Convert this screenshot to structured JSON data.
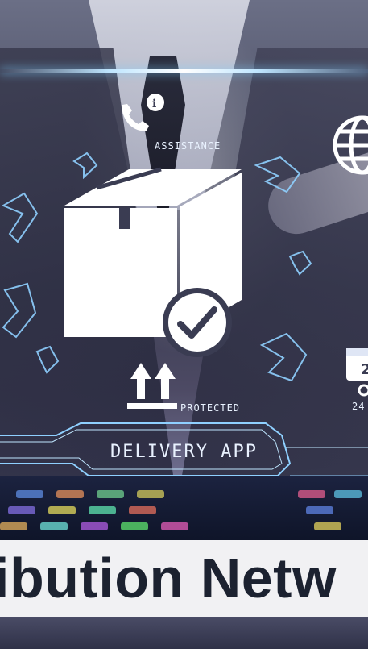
{
  "overlay_labels": {
    "assistance": "ASSISTANCE",
    "protected": "PROTECTED",
    "delivery_app": "DELIVERY APP",
    "badge_24": "24"
  },
  "banner": {
    "text": "ibution Netw"
  },
  "colors": {
    "hud_line": "#bfe6ff",
    "hud_outline": "#8fd0ff",
    "banner_bg": "#f1f1f3",
    "banner_text": "#1c2230"
  }
}
